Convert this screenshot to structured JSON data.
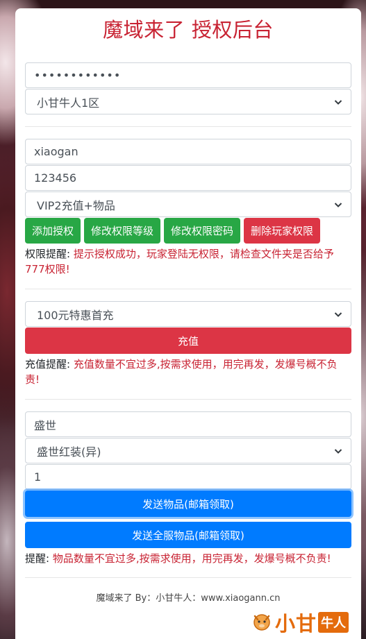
{
  "header": {
    "title": "魔域来了 授权后台"
  },
  "auth": {
    "password_value": "••••••••••••",
    "server_select": "小甘牛人1区"
  },
  "permission": {
    "username": "xiaogan",
    "password": "123456",
    "level_select": "VIP2充值+物品",
    "buttons": {
      "add": "添加授权",
      "modify_level": "修改权限等级",
      "modify_password": "修改权限密码",
      "delete": "删除玩家权限"
    },
    "note_label": "权限提醒:",
    "note_text": "提示授权成功，玩家登陆无权限，请检查文件夹是否给予777权限!"
  },
  "recharge": {
    "package_select": "100元特惠首充",
    "button": "充值",
    "note_label": "充值提醒:",
    "note_text": "充值数量不宜过多,按需求使用，用完再发，发爆号概不负责!"
  },
  "items": {
    "category": "盛世",
    "item_select": "盛世红装(异)",
    "quantity": "1",
    "send_button": "发送物品(邮箱领取)",
    "send_all_button": "发送全服物品(邮箱领取)",
    "note_label": "提醒:",
    "note_text": "物品数量不宜过多,按需求使用，用完再发，发爆号概不负责!"
  },
  "footer": {
    "text": "魔域来了 By：小甘牛人：www.xiaogann.cn"
  },
  "watermark": {
    "text": "小甘",
    "tag": "牛人"
  },
  "colors": {
    "title": "#c82333",
    "green": "#28a745",
    "red": "#dc3545",
    "blue": "#007bff"
  }
}
